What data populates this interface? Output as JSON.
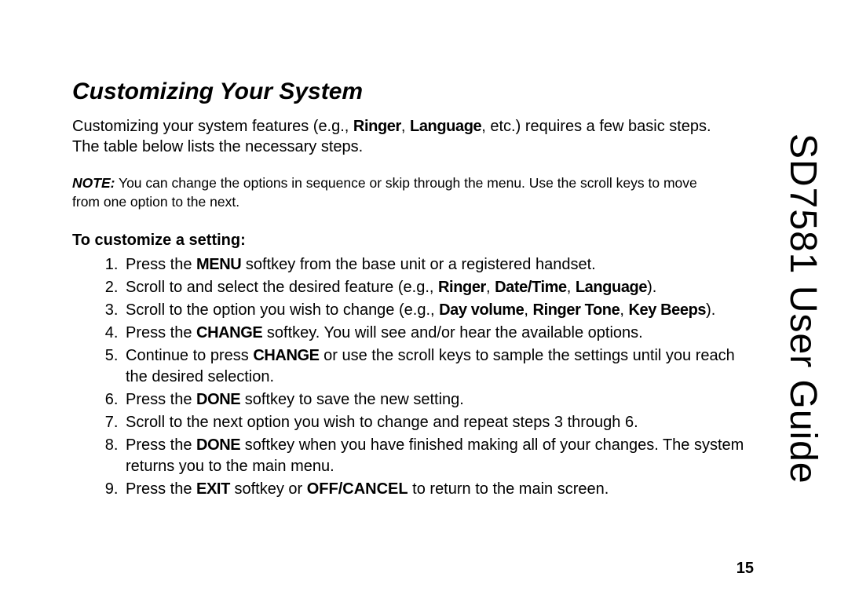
{
  "side_title": "SD7581 User Guide",
  "heading": "Customizing Your System",
  "intro": {
    "t1": "Customizing your system features (e.g., ",
    "b1": "Ringer",
    "t2": ", ",
    "b2": "Language",
    "t3": ", etc.) requires a few basic steps. The table below lists the necessary steps."
  },
  "note": {
    "label": "NOTE:",
    "text": "  You can change the options in sequence or skip through the menu. Use the scroll keys to move from one option to the next."
  },
  "sub_heading": "To customize a setting:",
  "steps": {
    "s1": {
      "t1": "Press the ",
      "b1": "MENU",
      "t2": " softkey from the base unit or a registered handset."
    },
    "s2": {
      "t1": "Scroll to and select the desired feature (e.g., ",
      "b1": "Ringer",
      "t2": ", ",
      "b2": "Date/Time",
      "t3": ", ",
      "b3": "Language",
      "t4": ")."
    },
    "s3": {
      "t1": "Scroll to the option you wish to change (e.g., ",
      "b1": "Day volume",
      "t2": ", ",
      "b2": "Ringer Tone",
      "t3": ", ",
      "b3": "Key Beeps",
      "t4": ")."
    },
    "s4": {
      "t1": "Press the ",
      "b1": "CHANGE",
      "t2": " softkey. You will see and/or hear the available options."
    },
    "s5": {
      "t1": "Continue to press ",
      "b1": "CHANGE",
      "t2": " or use the scroll keys to sample the settings until you reach the desired selection."
    },
    "s6": {
      "t1": "Press the ",
      "b1": "DONE",
      "t2": " softkey to save the new setting."
    },
    "s7": {
      "t1": "Scroll to the next option you wish to change and repeat steps 3 through 6."
    },
    "s8": {
      "t1": "Press the ",
      "b1": "DONE",
      "t2": " softkey when you have finished making all of your changes. The system returns you to the main menu."
    },
    "s9": {
      "t1": "Press the ",
      "b1": "EXIT",
      "t2": " softkey or ",
      "b2": "OFF/CANCEL",
      "t3": " to return to the main screen."
    }
  },
  "page_number": "15"
}
